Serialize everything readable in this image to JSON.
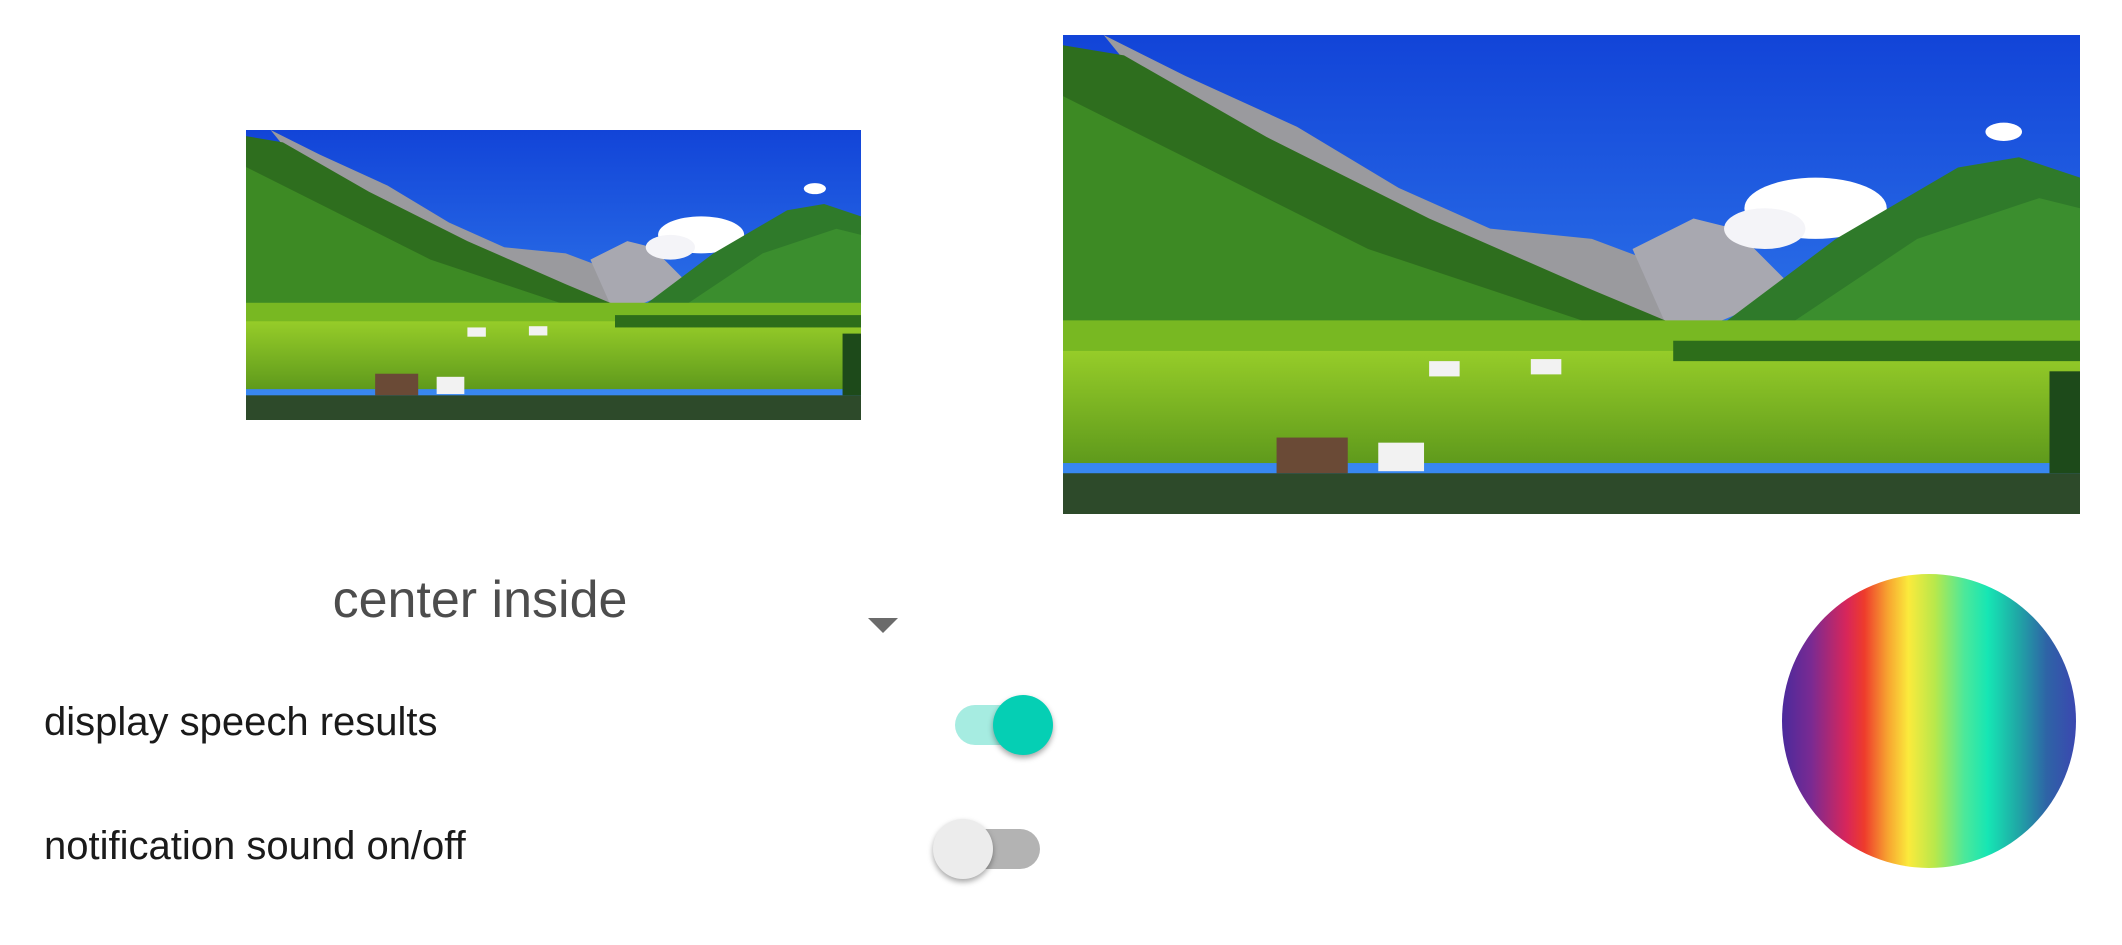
{
  "images": {
    "small": {
      "name": "alpine-valley-landscape"
    },
    "large": {
      "name": "alpine-valley-landscape"
    }
  },
  "scale_spinner": {
    "selected_value": "center inside"
  },
  "settings": {
    "speech": {
      "label": "display speech results",
      "enabled": true
    },
    "sound": {
      "label": "notification sound on/off",
      "enabled": false
    }
  },
  "colors": {
    "switch_on_thumb": "#05cfb4",
    "switch_on_track": "#a6ece1",
    "switch_off_thumb": "#ececec",
    "switch_off_track": "#b3b3b3",
    "text": "#1a1a1a",
    "spinner_text": "#4d4d4d"
  },
  "icons": {
    "spinner_arrow": "dropdown-arrow-icon"
  }
}
